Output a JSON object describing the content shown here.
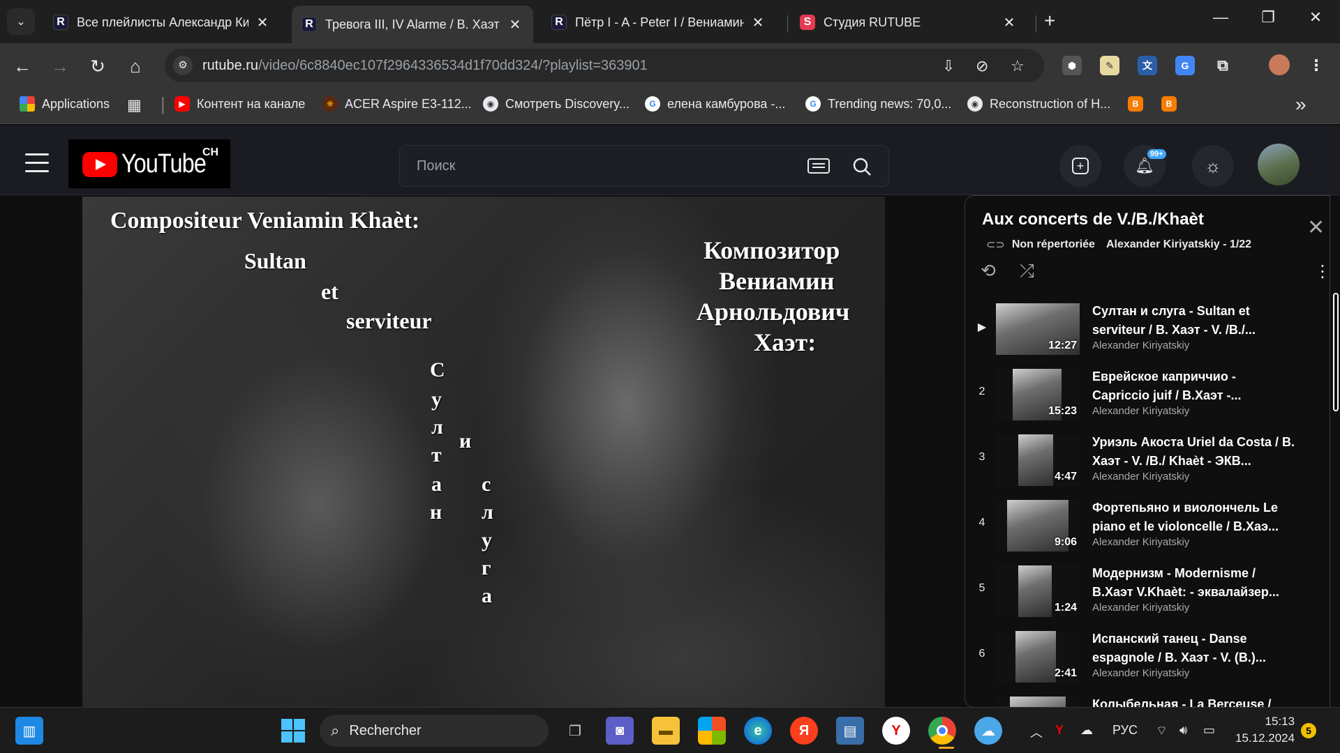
{
  "browser": {
    "tabs": [
      {
        "title": "Все плейлисты Александр Кир",
        "icon": "rutube-icon"
      },
      {
        "title": "Тревога III, IV Alarme / В. Хаэт",
        "icon": "rutube-icon",
        "active": true
      },
      {
        "title": "Пётр I - A - Peter I / Вениамин",
        "icon": "rutube-icon"
      },
      {
        "title": "Студия RUTUBE",
        "icon": "rutube-studio-icon"
      }
    ],
    "url_host": "rutube.ru",
    "url_path": "/video/6c8840ec107f2964336534d1f70dd324/?playlist=363901",
    "bookmarks": [
      {
        "label": "Applications"
      },
      {
        "label": "Контент на канале"
      },
      {
        "label": "ACER Aspire E3-112..."
      },
      {
        "label": "Смотреть Discovery..."
      },
      {
        "label": "елена камбурова -..."
      },
      {
        "label": "Trending news: 70,0..."
      },
      {
        "label": "Reconstruction of H..."
      }
    ],
    "more_bookmarks": "»"
  },
  "site": {
    "logo_text": "YouTube",
    "logo_sup": "CH",
    "search_placeholder": "Поиск",
    "notif_badge": "99+"
  },
  "video": {
    "overlay": {
      "fr_title": "Compositeur Veniamin Khaèt:",
      "fr_line1": "Sultan",
      "fr_line2": "et",
      "fr_line3": "serviteur",
      "ru_line1": "Композитор",
      "ru_line2": "Вениамин",
      "ru_line3": "Арнольдович",
      "ru_line4": "Хаэт:",
      "vertical_1": [
        "С",
        "у",
        "л",
        "т",
        "а",
        "н"
      ],
      "vertical_mid": "и",
      "vertical_2": [
        "с",
        "л",
        "у",
        "г",
        "а"
      ]
    }
  },
  "playlist": {
    "title": "Aux concerts de V./B./Khaèt",
    "visibility": "Non répertoriée",
    "owner_progress": "Alexander Kiriyatskiy - 1/22",
    "items": [
      {
        "index": "▶",
        "title": "Султан и слуга - Sultan et serviteur / В. Хаэт - V. /B./...",
        "channel": "Alexander Kiriyatskiy",
        "duration": "12:27"
      },
      {
        "index": "2",
        "title": "Еврейское каприччио - Capriccio juif / В.Хаэт -...",
        "channel": "Alexander Kiriyatskiy",
        "duration": "15:23"
      },
      {
        "index": "3",
        "title": "Уриэль Акоста Uriel da Costa / В. Хаэт - V. /B./ Khaèt - ЭКВ...",
        "channel": "Alexander Kiriyatskiy",
        "duration": "4:47"
      },
      {
        "index": "4",
        "title": "Фортепьяно и виолончель Le piano et le violoncelle / В.Хаэ...",
        "channel": "Alexander Kiriyatskiy",
        "duration": "9:06"
      },
      {
        "index": "5",
        "title": "Модернизм - Modernisme / В.Хаэт V.Khaèt: - эквалайзер...",
        "channel": "Alexander Kiriyatskiy",
        "duration": "1:24"
      },
      {
        "index": "6",
        "title": "Испанский танец - Danse espagnole / В. Хаэт - V. (B.)...",
        "channel": "Alexander Kiriyatskiy",
        "duration": "2:41"
      },
      {
        "index": "",
        "title": "Колыбельная - La Berceuse /",
        "channel": "",
        "duration": ""
      }
    ]
  },
  "taskbar": {
    "search_label": "Rechercher",
    "lang": "РУС",
    "time": "15:13",
    "date": "15.12.2024",
    "notifications": "5"
  }
}
